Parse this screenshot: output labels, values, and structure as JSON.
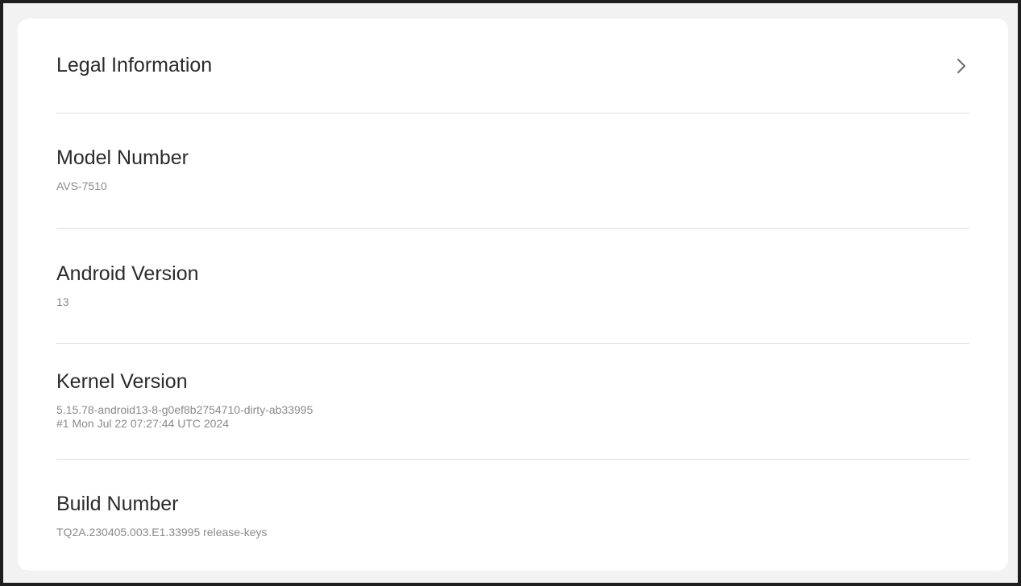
{
  "items": [
    {
      "title": "Legal Information"
    },
    {
      "title": "Model Number",
      "value": "AVS-7510"
    },
    {
      "title": "Android Version",
      "value": "13"
    },
    {
      "title": "Kernel Version",
      "value_line1": "5.15.78-android13-8-g0ef8b2754710-dirty-ab33995",
      "value_line2": "#1 Mon Jul 22 07:27:44 UTC 2024"
    },
    {
      "title": "Build Number",
      "value": "TQ2A.230405.003.E1.33995 release-keys"
    }
  ],
  "icons": {
    "legal_chevron": "chevron-right-icon"
  },
  "colors": {
    "background": "#f2f2f2",
    "card": "#ffffff",
    "title": "#2b2b2b",
    "subtitle": "#8a8a8a",
    "divider": "#dcdcdc"
  }
}
